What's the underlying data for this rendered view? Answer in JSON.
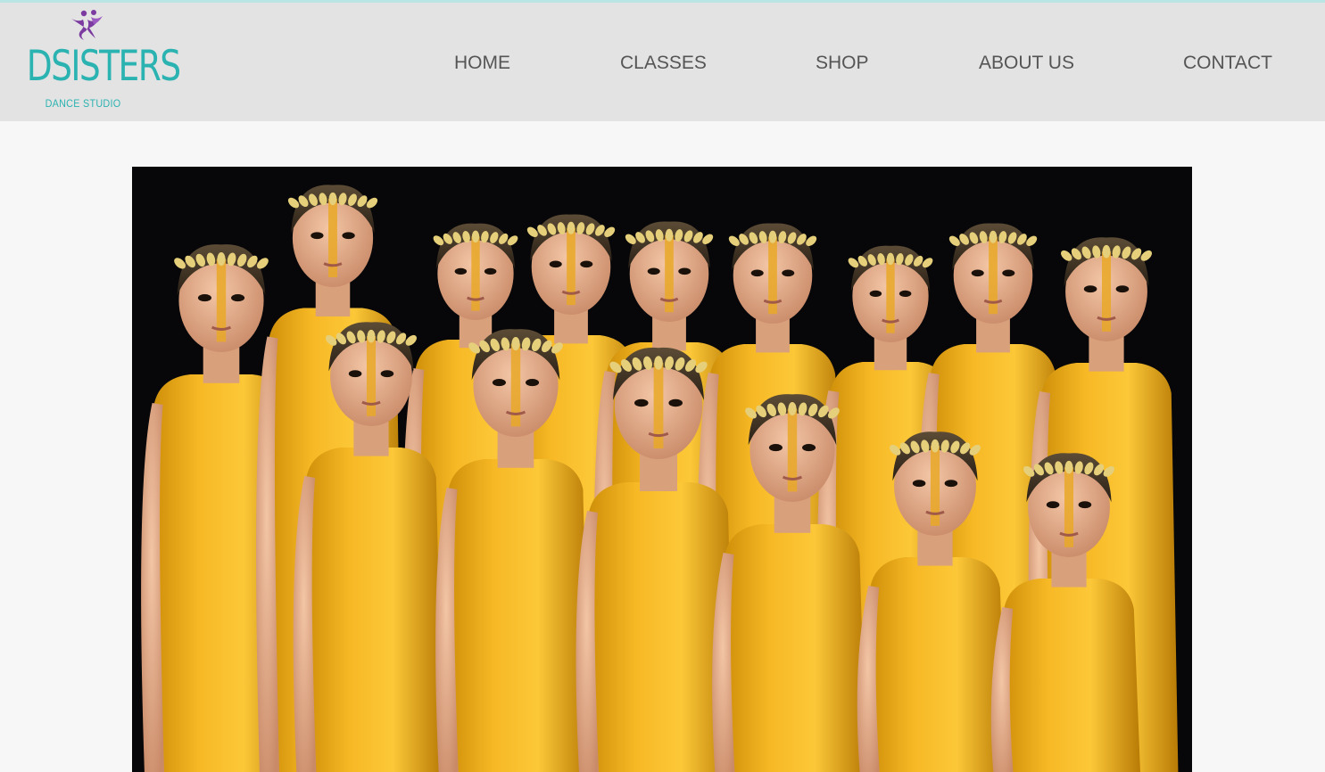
{
  "brand": {
    "name": "DSISTERS",
    "tagline": "DANCE STUDIO",
    "icon": "dancers-logo-icon",
    "colors": {
      "teal": "#2bb3b1",
      "purple": "#7b3ba0",
      "header_bg": "#e3e3e3",
      "accent_bar": "#b9e6e4"
    }
  },
  "nav": {
    "items": [
      {
        "label": "HOME"
      },
      {
        "label": "CLASSES"
      },
      {
        "label": "SHOP"
      },
      {
        "label": "ABOUT US"
      },
      {
        "label": "CONTACT"
      }
    ]
  },
  "hero": {
    "image": "group-photo-of-dancers-in-gold-leotards-with-leaf-crowns"
  }
}
